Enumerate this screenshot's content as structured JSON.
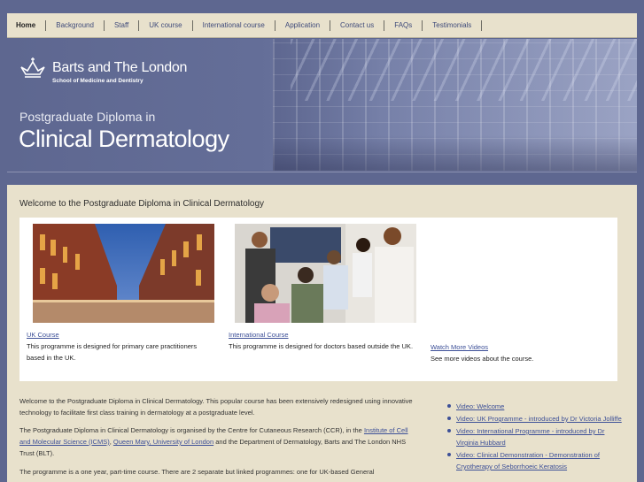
{
  "nav": {
    "items": [
      "Home",
      "Background",
      "Staff",
      "UK course",
      "International course",
      "Application",
      "Contact us",
      "FAQs",
      "Testimonials"
    ]
  },
  "banner": {
    "institution": "Barts and The London",
    "school": "School of Medicine and Dentistry",
    "course_prefix": "Postgraduate Diploma in",
    "course_title": "Clinical Dermatology",
    "crown_icon": "crown-icon"
  },
  "main": {
    "welcome_title": "Welcome to the Postgraduate Diploma in Clinical Dermatology",
    "cards": [
      {
        "link": "UK Course",
        "text": "This programme is designed for primary care practitioners based in the UK."
      },
      {
        "link": "International Course",
        "text": "This programme is designed for doctors based outside the UK."
      },
      {
        "link": "Watch More Videos",
        "text": "See more videos about the course."
      }
    ],
    "para1": "Welcome to the Postgraduate Diploma in Clinical Dermatology. This popular course has been extensively redesigned using innovative technology to facilitate first class training in dermatology at a postgraduate level.",
    "para2": {
      "before": "The Postgraduate Diploma in Clinical Dermatology is organised by the Centre for Cutaneous Research (CCR), in the ",
      "link1": "Institute of Cell and Molecular Science (ICMS)",
      "mid": ", ",
      "link2": "Queen Mary, University of London",
      "after": " and the Department of Dermatology, Barts and The London NHS Trust (BLT)."
    },
    "para3": "The programme is a one year, part-time course. There are 2 separate but linked programmes: one for UK-based General",
    "videos": [
      "Video: Welcome",
      "Video: UK Programme - introduced by Dr Victoria Jolliffe",
      "Video: International Programme - introduced by Dr Virginia Hubbard",
      "Video: Clinical Demonstration - Demonstration of Cryotherapy of Seborrhoeic Keratosis"
    ]
  },
  "colors": {
    "page_bg": "#5e6790",
    "content_bg": "#e8e1cc",
    "link": "#3c4f97"
  }
}
